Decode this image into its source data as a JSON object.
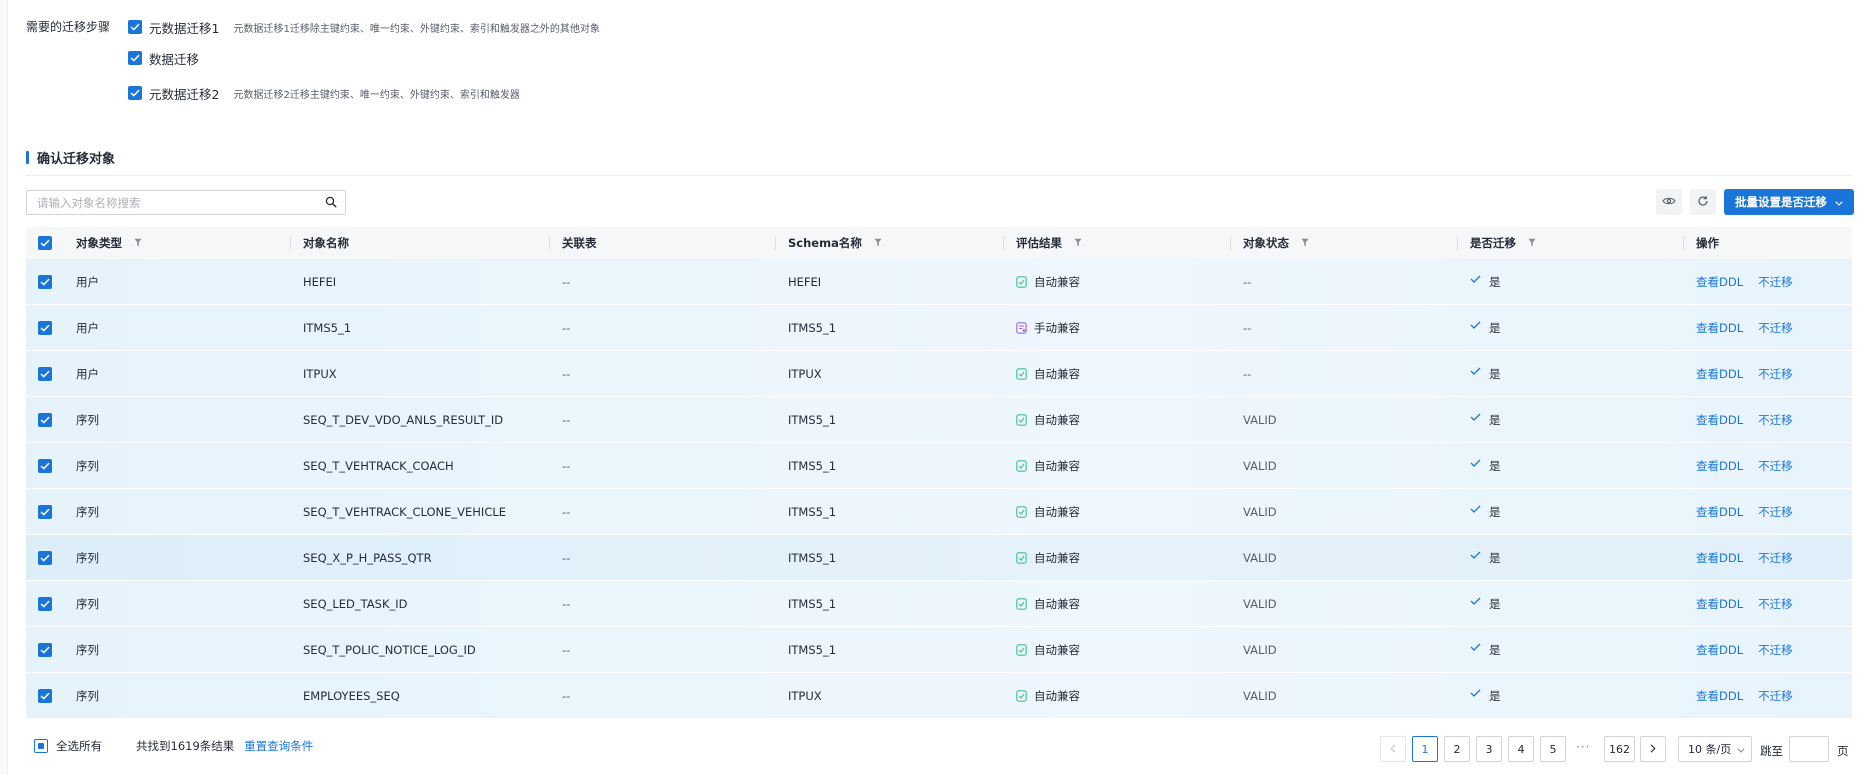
{
  "steps": {
    "label": "需要的迁移步骤",
    "items": [
      {
        "label": "元数据迁移1",
        "desc": "元数据迁移1迁移除主键约束、唯一约束、外键约束、索引和触发器之外的其他对象"
      },
      {
        "label": "数据迁移",
        "desc": ""
      },
      {
        "label": "元数据迁移2",
        "desc": "元数据迁移2迁移主键约束、唯一约束、外键约束、索引和触发器"
      }
    ]
  },
  "section": {
    "title": "确认迁移对象"
  },
  "toolbar": {
    "search_placeholder": "请输入对象名称搜索",
    "batch_button": "批量设置是否迁移"
  },
  "table": {
    "headers": [
      "对象类型",
      "对象名称",
      "关联表",
      "Schema名称",
      "评估结果",
      "对象状态",
      "是否迁移",
      "操作"
    ],
    "rows": [
      {
        "type": "用户",
        "name": "HEFEI",
        "rel": "--",
        "schema": "HEFEI",
        "result": "自动兼容",
        "result_kind": "auto",
        "status": "--",
        "migrate": "是"
      },
      {
        "type": "用户",
        "name": "ITMS5_1",
        "rel": "--",
        "schema": "ITMS5_1",
        "result": "手动兼容",
        "result_kind": "manual",
        "status": "--",
        "migrate": "是"
      },
      {
        "type": "用户",
        "name": "ITPUX",
        "rel": "--",
        "schema": "ITPUX",
        "result": "自动兼容",
        "result_kind": "auto",
        "status": "--",
        "migrate": "是"
      },
      {
        "type": "序列",
        "name": "SEQ_T_DEV_VDO_ANLS_RESULT_ID",
        "rel": "--",
        "schema": "ITMS5_1",
        "result": "自动兼容",
        "result_kind": "auto",
        "status": "VALID",
        "migrate": "是"
      },
      {
        "type": "序列",
        "name": "SEQ_T_VEHTRACK_COACH",
        "rel": "--",
        "schema": "ITMS5_1",
        "result": "自动兼容",
        "result_kind": "auto",
        "status": "VALID",
        "migrate": "是"
      },
      {
        "type": "序列",
        "name": "SEQ_T_VEHTRACK_CLONE_VEHICLE",
        "rel": "--",
        "schema": "ITMS5_1",
        "result": "自动兼容",
        "result_kind": "auto",
        "status": "VALID",
        "migrate": "是"
      },
      {
        "type": "序列",
        "name": "SEQ_X_P_H_PASS_QTR",
        "rel": "--",
        "schema": "ITMS5_1",
        "result": "自动兼容",
        "result_kind": "auto",
        "status": "VALID",
        "migrate": "是"
      },
      {
        "type": "序列",
        "name": "SEQ_LED_TASK_ID",
        "rel": "--",
        "schema": "ITMS5_1",
        "result": "自动兼容",
        "result_kind": "auto",
        "status": "VALID",
        "migrate": "是"
      },
      {
        "type": "序列",
        "name": "SEQ_T_POLIC_NOTICE_LOG_ID",
        "rel": "--",
        "schema": "ITMS5_1",
        "result": "自动兼容",
        "result_kind": "auto",
        "status": "VALID",
        "migrate": "是"
      },
      {
        "type": "序列",
        "name": "EMPLOYEES_SEQ",
        "rel": "--",
        "schema": "ITPUX",
        "result": "自动兼容",
        "result_kind": "auto",
        "status": "VALID",
        "migrate": "是"
      }
    ],
    "actions": [
      "查看DDL",
      "不迁移"
    ]
  },
  "footer": {
    "select_all": "全选所有",
    "count_text": "共找到1619条结果",
    "reset": "重置查询条件"
  },
  "pagination": {
    "pages": [
      "1",
      "2",
      "3",
      "4",
      "5"
    ],
    "ellipsis": "···",
    "last": "162",
    "current": "1",
    "page_size": "10 条/页",
    "jump_label": "跳至",
    "page_label": "页"
  },
  "colors": {
    "primary": "#1a75d8",
    "auto_icon": "#3fbf90",
    "manual_icon": "#9b6ad8"
  }
}
